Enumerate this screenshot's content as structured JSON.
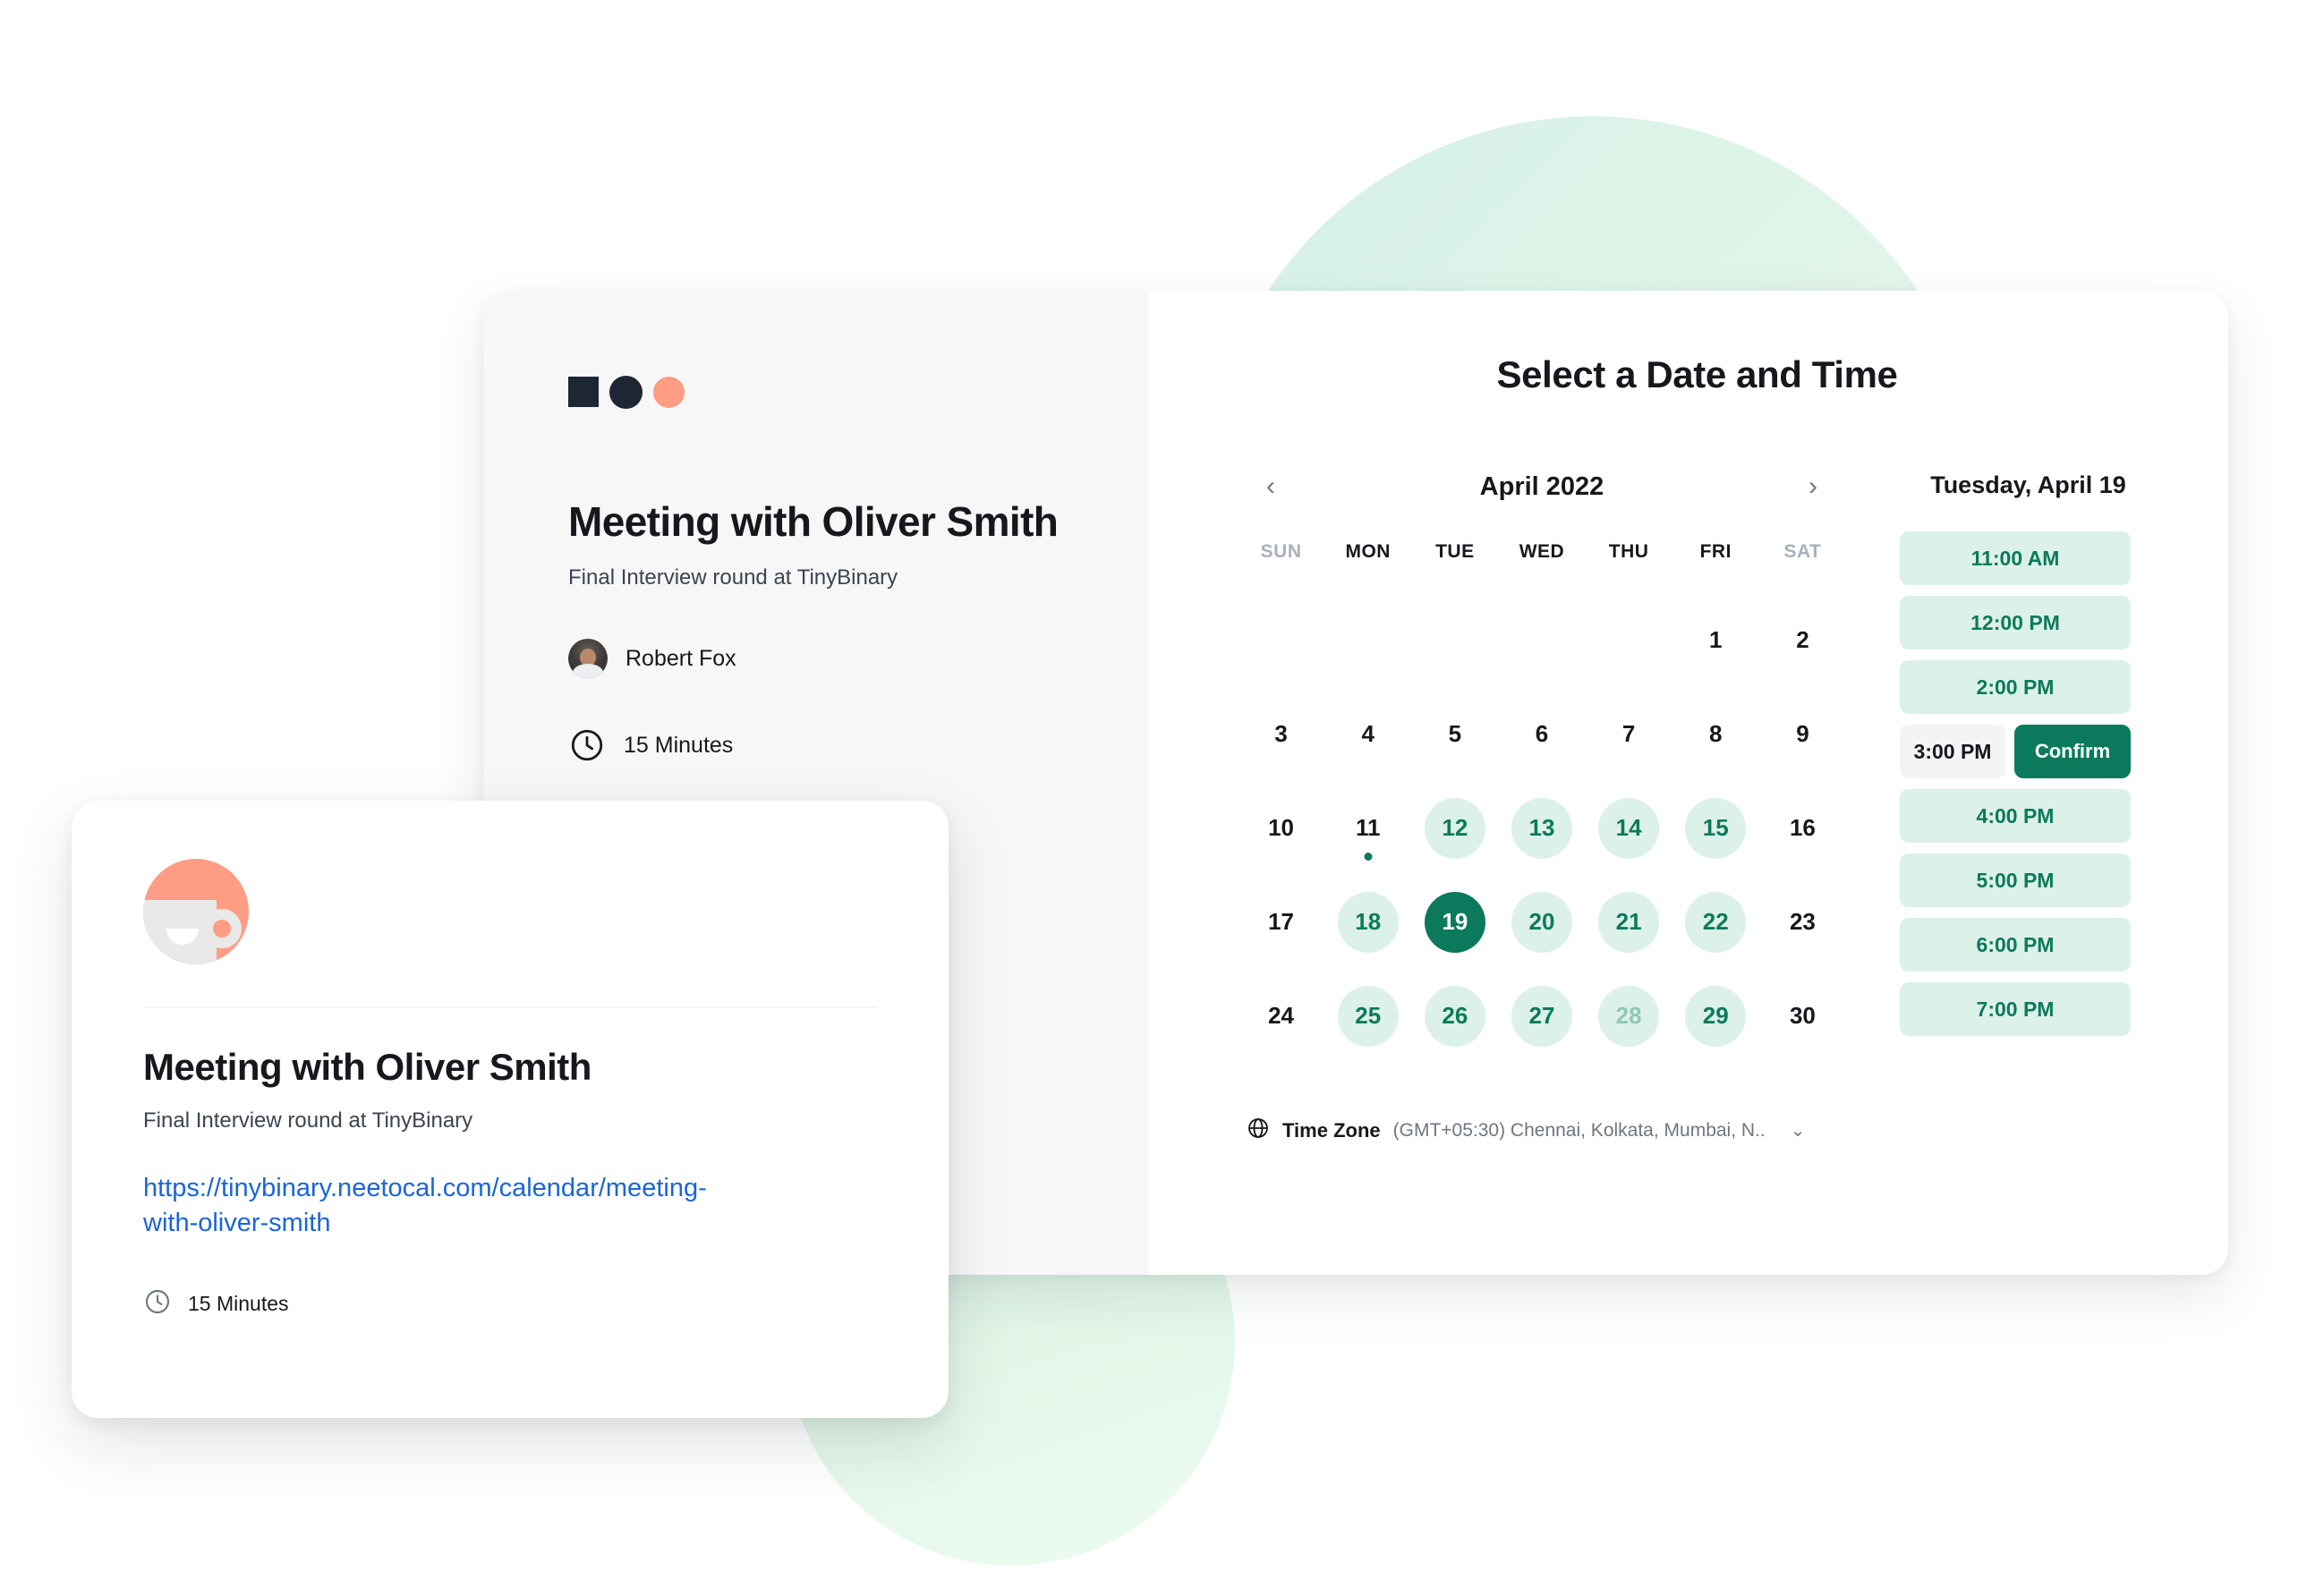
{
  "event_panel": {
    "logo": [
      "logo-square",
      "logo-circle-dark",
      "logo-circle-salmon"
    ],
    "title": "Meeting with Oliver Smith",
    "subtitle": "Final Interview round at TinyBinary",
    "host_name": "Robert Fox",
    "duration": "15 Minutes"
  },
  "scheduler": {
    "title": "Select a Date and Time",
    "month_label": "April 2022",
    "prev_label": "‹",
    "next_label": "›",
    "day_headers": [
      "SUN",
      "MON",
      "TUE",
      "WED",
      "THU",
      "FRI",
      "SAT"
    ],
    "weeks": [
      [
        {
          "label": "",
          "state": "empty"
        },
        {
          "label": "",
          "state": "empty"
        },
        {
          "label": "",
          "state": "empty"
        },
        {
          "label": "",
          "state": "empty"
        },
        {
          "label": "",
          "state": "empty"
        },
        {
          "label": "1",
          "state": "plain"
        },
        {
          "label": "2",
          "state": "plain"
        }
      ],
      [
        {
          "label": "3",
          "state": "plain"
        },
        {
          "label": "4",
          "state": "plain"
        },
        {
          "label": "5",
          "state": "plain"
        },
        {
          "label": "6",
          "state": "plain"
        },
        {
          "label": "7",
          "state": "plain"
        },
        {
          "label": "8",
          "state": "plain"
        },
        {
          "label": "9",
          "state": "plain"
        }
      ],
      [
        {
          "label": "10",
          "state": "plain"
        },
        {
          "label": "11",
          "state": "today"
        },
        {
          "label": "12",
          "state": "available"
        },
        {
          "label": "13",
          "state": "available"
        },
        {
          "label": "14",
          "state": "available"
        },
        {
          "label": "15",
          "state": "available"
        },
        {
          "label": "16",
          "state": "plain"
        }
      ],
      [
        {
          "label": "17",
          "state": "plain"
        },
        {
          "label": "18",
          "state": "available"
        },
        {
          "label": "19",
          "state": "selected"
        },
        {
          "label": "20",
          "state": "available"
        },
        {
          "label": "21",
          "state": "available"
        },
        {
          "label": "22",
          "state": "available"
        },
        {
          "label": "23",
          "state": "plain"
        }
      ],
      [
        {
          "label": "24",
          "state": "plain"
        },
        {
          "label": "25",
          "state": "available"
        },
        {
          "label": "26",
          "state": "available"
        },
        {
          "label": "27",
          "state": "available"
        },
        {
          "label": "28",
          "state": "available-muted"
        },
        {
          "label": "29",
          "state": "available"
        },
        {
          "label": "30",
          "state": "plain"
        }
      ]
    ],
    "timezone_label": "Time Zone",
    "timezone_value": "(GMT+05:30) Chennai, Kolkata, Mumbai, N..",
    "timezone_caret": "⌄",
    "selected_date_label": "Tuesday, April 19",
    "slots": [
      {
        "time": "11:00 AM",
        "state": "available"
      },
      {
        "time": "12:00 PM",
        "state": "available"
      },
      {
        "time": "2:00 PM",
        "state": "available"
      },
      {
        "time": "3:00 PM",
        "state": "confirming",
        "confirm_label": "Confirm"
      },
      {
        "time": "4:00 PM",
        "state": "available"
      },
      {
        "time": "5:00 PM",
        "state": "available"
      },
      {
        "time": "6:00 PM",
        "state": "available"
      },
      {
        "time": "7:00 PM",
        "state": "available"
      }
    ]
  },
  "preview_card": {
    "title": "Meeting with Oliver Smith",
    "subtitle": "Final Interview round at TinyBinary",
    "link": "https://tinybinary.neetocal.com/calendar/meeting-with-oliver-smith",
    "duration": "15 Minutes"
  },
  "colors": {
    "accent_green": "#0b7a5c",
    "soft_green": "#dcf1e8",
    "salmon": "#ff9c84",
    "navy": "#1f2633",
    "link_blue": "#1a65d8",
    "panel_grey": "#f7f7f8"
  }
}
